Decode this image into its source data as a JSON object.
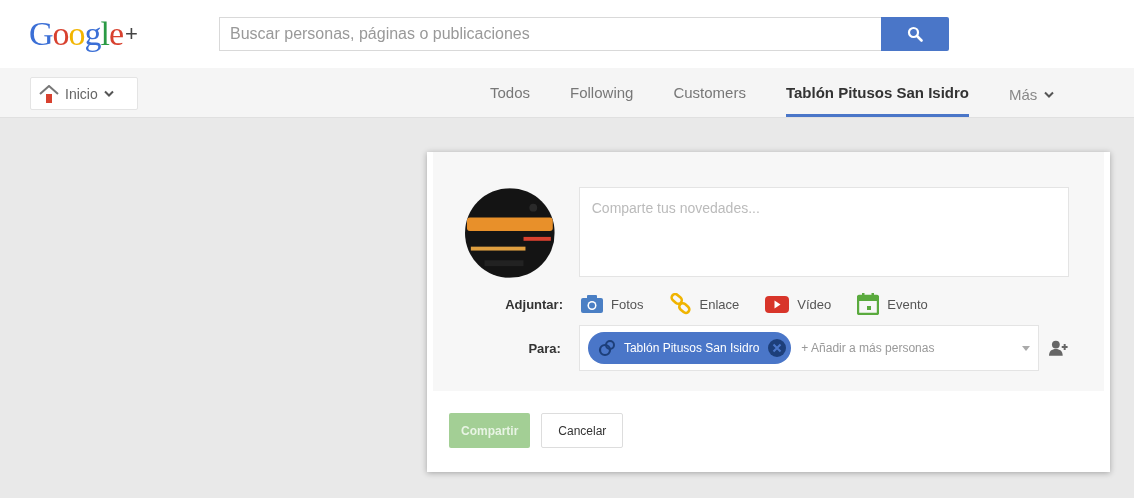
{
  "header": {
    "logo": "Google",
    "logo_plus": "+",
    "search": {
      "placeholder": "Buscar personas, páginas o publicaciones"
    }
  },
  "nav": {
    "home": {
      "label": "Inicio"
    },
    "tabs": [
      {
        "label": "Todos",
        "selected": false
      },
      {
        "label": "Following",
        "selected": false
      },
      {
        "label": "Customers",
        "selected": false
      },
      {
        "label": "Tablón Pitusos San Isidro",
        "selected": true
      }
    ],
    "more": {
      "label": "Más"
    }
  },
  "share_box": {
    "post_field": {
      "placeholder": "Comparte tus novedades..."
    },
    "attach_label": "Adjuntar:",
    "attachments": [
      {
        "label": "Fotos"
      },
      {
        "kind": "link",
        "label": "Enlace"
      },
      {
        "kind": "video",
        "label": "Vídeo"
      },
      {
        "kind": "event",
        "label": "Evento"
      }
    ],
    "audience_label": "Para:",
    "audience_chip": "Tablón Pitusos San Isidro",
    "audience_placeholder": "+ Añadir a más personas",
    "buttons": [
      {
        "label": "Compartir",
        "disabled": true
      },
      {
        "label": "Cancelar",
        "disabled": false
      }
    ]
  }
}
